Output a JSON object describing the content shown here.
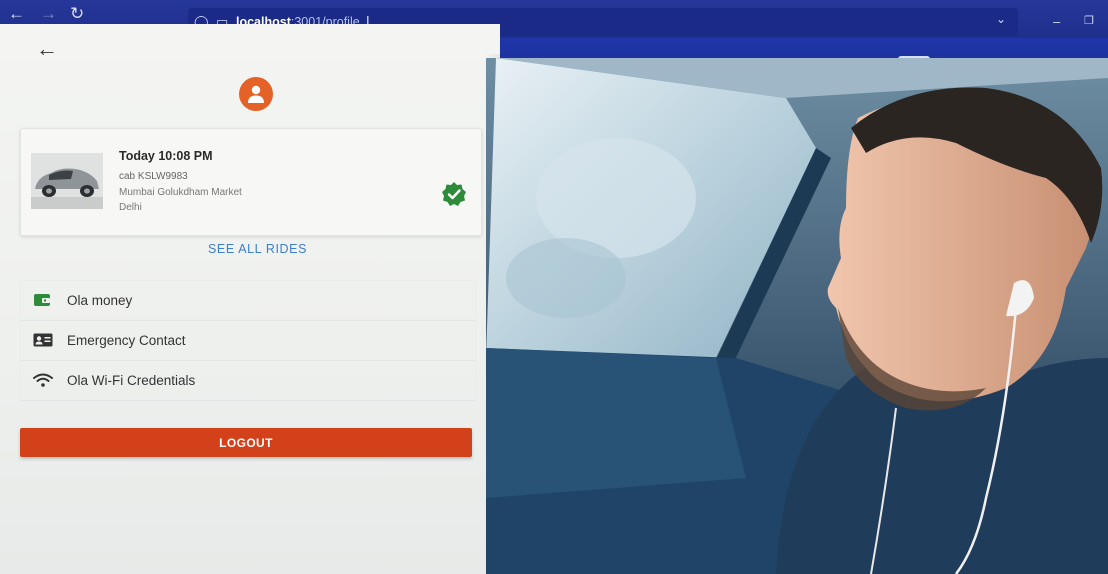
{
  "browser": {
    "url_host": "localhost",
    "url_rest": ":3001/profile",
    "zoom": "110%"
  },
  "profile": {
    "ride": {
      "time": "Today 10:08 PM",
      "cab": "cab KSLW9983",
      "from": "Mumbai Golukdham Market",
      "to": "Delhi"
    },
    "see_all_label": "SEE ALL RIDES",
    "menu": [
      {
        "label": "Ola money",
        "icon": "wallet-icon"
      },
      {
        "label": "Emergency Contact",
        "icon": "contact-card-icon"
      },
      {
        "label": "Ola Wi-Fi Credentials",
        "icon": "wifi-icon"
      }
    ],
    "logout_label": "LOGOUT"
  },
  "colors": {
    "accent": "#d2411a",
    "avatar": "#e46227",
    "link": "#3b7fd0",
    "verified": "#2e8b3a",
    "menu_icon": "#2e8b3a"
  },
  "hero": {
    "icon": "man-driving-car-photo"
  }
}
